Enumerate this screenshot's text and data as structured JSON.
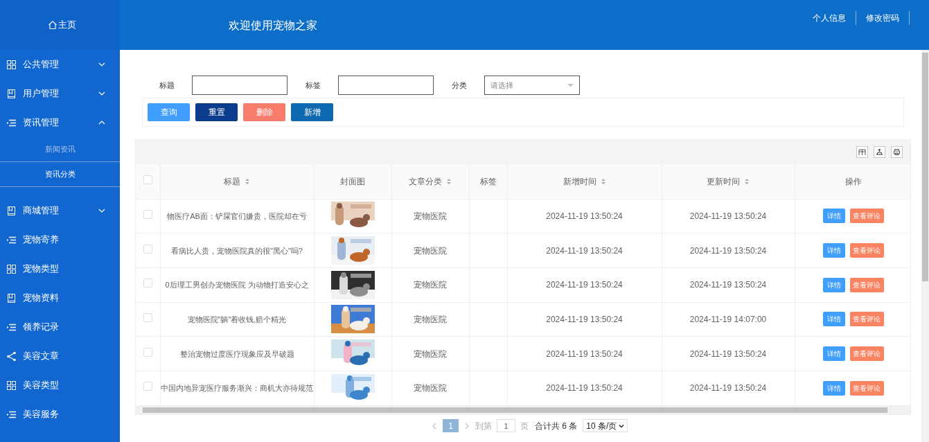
{
  "sidebar": {
    "home": "主页",
    "items": [
      {
        "label": "公共管理",
        "kind": "grid",
        "expanded": false
      },
      {
        "label": "用户管理",
        "kind": "book",
        "expanded": false
      },
      {
        "label": "资讯管理",
        "kind": "list",
        "expanded": true,
        "children": [
          {
            "label": "新闻资讯",
            "selected": true
          },
          {
            "label": "资讯分类",
            "selected": false
          }
        ]
      },
      {
        "label": "商城管理",
        "kind": "book",
        "expanded": false
      },
      {
        "label": "宠物寄养",
        "kind": "list"
      },
      {
        "label": "宠物类型",
        "kind": "grid"
      },
      {
        "label": "宠物资料",
        "kind": "book"
      },
      {
        "label": "领养记录",
        "kind": "list"
      },
      {
        "label": "美容文章",
        "kind": "share"
      },
      {
        "label": "美容类型",
        "kind": "grid"
      },
      {
        "label": "美容服务",
        "kind": "list"
      }
    ]
  },
  "header": {
    "title": "欢迎使用宠物之家",
    "links": [
      "个人信息",
      "修改密码"
    ]
  },
  "search": {
    "fields": [
      {
        "label": "标题",
        "kind": "input"
      },
      {
        "label": "标签",
        "kind": "input"
      },
      {
        "label": "分类",
        "kind": "select",
        "placeholder": "请选择"
      }
    ],
    "buttons": [
      {
        "label": "查询",
        "color": "#409eff"
      },
      {
        "label": "重置",
        "color": "#0b3d8c"
      },
      {
        "label": "删除",
        "color": "#f87c6c"
      },
      {
        "label": "新增",
        "color": "#0e69b0"
      }
    ]
  },
  "table": {
    "select_all": {
      "checked": false
    },
    "columns": [
      {
        "label": "标题",
        "sortable": true
      },
      {
        "label": "封面图",
        "sortable": false
      },
      {
        "label": "文章分类",
        "sortable": true
      },
      {
        "label": "标签",
        "sortable": false
      },
      {
        "label": "新增时间",
        "sortable": true
      },
      {
        "label": "更新时间",
        "sortable": true
      },
      {
        "label": "操作",
        "sortable": false
      }
    ],
    "rows": [
      {
        "checked": false,
        "title": "物医疗AB面：铲屎官们嫌贵，医院却在亏",
        "cover": {
          "kind": "picture"
        },
        "category": "宠物医院",
        "created": "2024-11-19 13:50:24",
        "updated": "2024-11-19 13:50:24",
        "actions": [
          "详情",
          "查看评论"
        ]
      },
      {
        "checked": false,
        "title": "看病比人贵，宠物医院真的很\"黑心\"吗?",
        "cover": {
          "kind": "picture"
        },
        "category": "宠物医院",
        "created": "2024-11-19 13:50:24",
        "updated": "2024-11-19 13:50:24",
        "actions": [
          "详情",
          "查看评论"
        ]
      },
      {
        "checked": false,
        "title": "0后理工男创办宠物医院 为动物打造安心之",
        "cover": {
          "kind": "picture"
        },
        "category": "宠物医院",
        "created": "2024-11-19 13:50:24",
        "updated": "2024-11-19 13:50:24",
        "actions": [
          "详情",
          "查看评论"
        ]
      },
      {
        "checked": false,
        "title": "宠物医院\"躺\"着收钱,赔个精光",
        "cover": {
          "kind": "picture"
        },
        "category": "宠物医院",
        "created": "2024-11-19 13:50:24",
        "updated": "2024-11-19 14:07:00",
        "actions": [
          "详情",
          "查看评论"
        ]
      },
      {
        "checked": false,
        "title": "整治宠物过度医疗现象应及早破题",
        "cover": {
          "kind": "picture"
        },
        "category": "宠物医院",
        "created": "2024-11-19 13:50:24",
        "updated": "2024-11-19 13:50:24",
        "actions": [
          "详情",
          "查看评论"
        ]
      },
      {
        "checked": false,
        "title": "中国内地异宠医疗服务渐兴：商机大亦待规范",
        "cover": {
          "kind": "picture"
        },
        "category": "宠物医院",
        "created": "2024-11-19 13:50:24",
        "updated": "2024-11-19 13:50:24",
        "actions": [
          "详情",
          "查看评论"
        ]
      }
    ]
  },
  "pagination": {
    "pages": [
      {
        "label": "1",
        "selected": true
      }
    ],
    "goto_label": "到第",
    "goto_value": "1",
    "page_unit": "页",
    "total": "合计共 6 条",
    "page_size": "10 条/页"
  }
}
